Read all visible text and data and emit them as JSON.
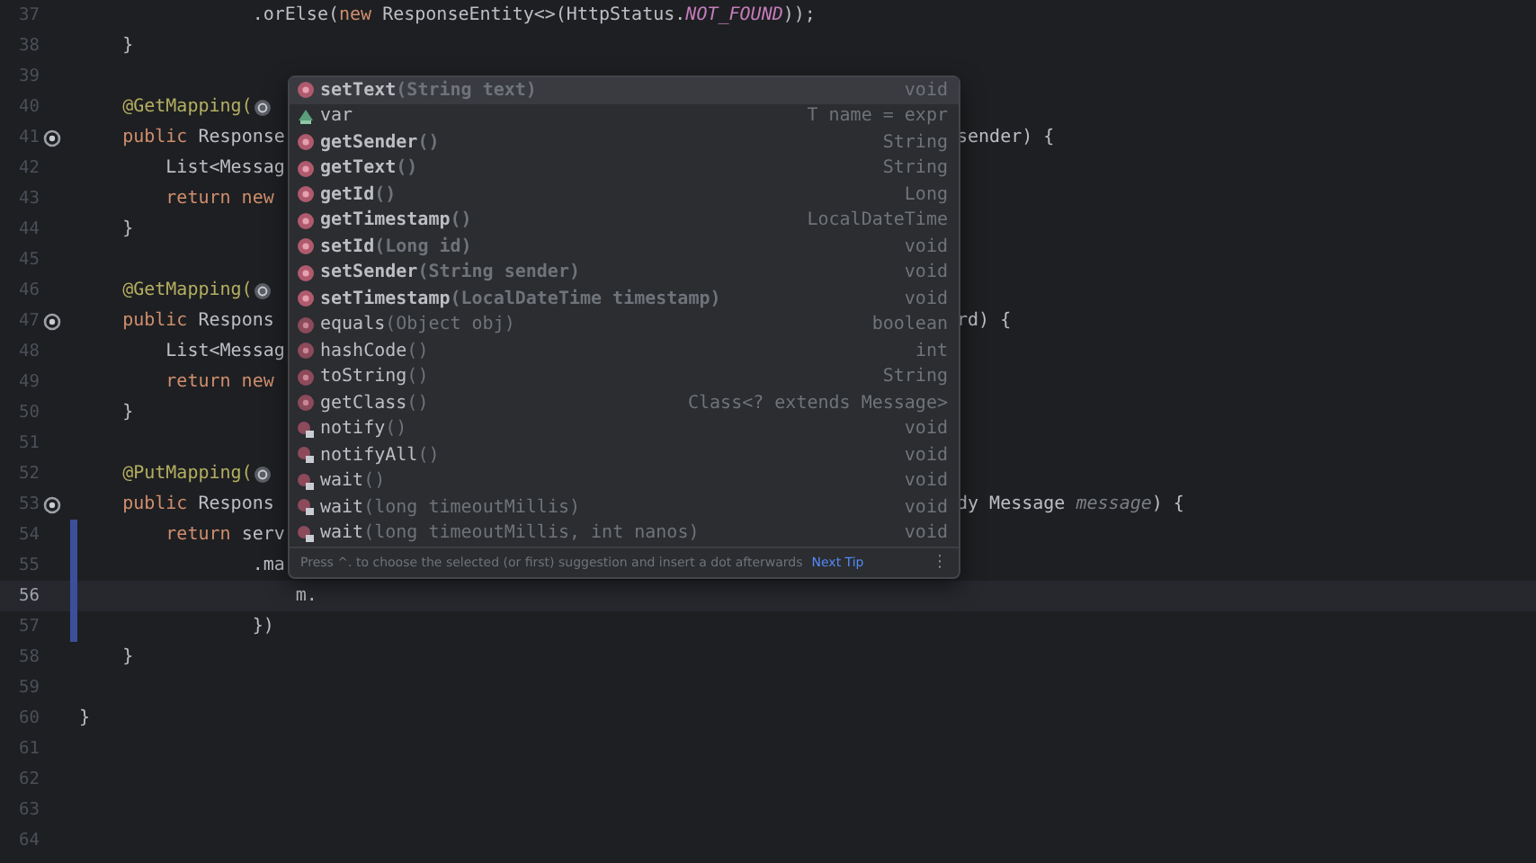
{
  "editor": {
    "lines": [
      {
        "number": "37",
        "segments": [
          {
            "text": "                .orElse(",
            "kind": "plain"
          },
          {
            "text": "new",
            "kind": "keyword"
          },
          {
            "text": " ResponseEntity<>(HttpStatus.",
            "kind": "plain"
          },
          {
            "text": "NOT_FOUND",
            "kind": "constant"
          },
          {
            "text": "));",
            "kind": "plain"
          }
        ]
      },
      {
        "number": "38",
        "segments": [
          {
            "text": "    }",
            "kind": "plain"
          }
        ]
      },
      {
        "number": "39"
      },
      {
        "number": "40",
        "segments": [
          {
            "text": "    @GetMapping(",
            "kind": "annotation"
          }
        ],
        "hint": true
      },
      {
        "number": "41",
        "segments": [
          {
            "text": "    public",
            "kind": "keyword"
          },
          {
            "text": " Response",
            "kind": "plain"
          }
        ],
        "right": [
          {
            "text": "sender) {",
            "kind": "plain"
          }
        ],
        "gutter_icon": true
      },
      {
        "number": "42",
        "segments": [
          {
            "text": "        List<Messag",
            "kind": "plain"
          }
        ]
      },
      {
        "number": "43",
        "segments": [
          {
            "text": "        return new",
            "kind": "keyword"
          }
        ]
      },
      {
        "number": "44",
        "segments": [
          {
            "text": "    }",
            "kind": "plain"
          }
        ]
      },
      {
        "number": "45"
      },
      {
        "number": "46",
        "segments": [
          {
            "text": "    @GetMapping(",
            "kind": "annotation"
          }
        ],
        "hint": true
      },
      {
        "number": "47",
        "segments": [
          {
            "text": "    public",
            "kind": "keyword"
          },
          {
            "text": " Respons",
            "kind": "plain"
          }
        ],
        "right": [
          {
            "text": "rd) {",
            "kind": "plain"
          }
        ],
        "gutter_icon": true
      },
      {
        "number": "48",
        "segments": [
          {
            "text": "        List<Messag",
            "kind": "plain"
          }
        ]
      },
      {
        "number": "49",
        "segments": [
          {
            "text": "        return new",
            "kind": "keyword"
          }
        ]
      },
      {
        "number": "50",
        "segments": [
          {
            "text": "    }",
            "kind": "plain"
          }
        ]
      },
      {
        "number": "51"
      },
      {
        "number": "52",
        "segments": [
          {
            "text": "    @PutMapping(",
            "kind": "annotation"
          }
        ],
        "hint": true
      },
      {
        "number": "53",
        "segments": [
          {
            "text": "    public",
            "kind": "keyword"
          },
          {
            "text": " Respons",
            "kind": "plain"
          }
        ],
        "right": [
          {
            "text": "dy Message ",
            "kind": "plain"
          },
          {
            "text": "message",
            "kind": "param"
          },
          {
            "text": ") {",
            "kind": "plain"
          }
        ],
        "gutter_icon": true
      },
      {
        "number": "54",
        "segments": [
          {
            "text": "        return",
            "kind": "keyword"
          },
          {
            "text": " serv",
            "kind": "plain"
          }
        ],
        "changed": true
      },
      {
        "number": "55",
        "segments": [
          {
            "text": "                .ma",
            "kind": "plain"
          }
        ],
        "changed": true
      },
      {
        "number": "56",
        "segments": [
          {
            "text": "                    m.",
            "kind": "plain"
          }
        ],
        "changed": true,
        "current": true
      },
      {
        "number": "57",
        "segments": [
          {
            "text": "                })",
            "kind": "plain"
          }
        ],
        "changed": true
      },
      {
        "number": "58",
        "segments": [
          {
            "text": "    }",
            "kind": "plain"
          }
        ]
      },
      {
        "number": "59"
      },
      {
        "number": "60",
        "segments": [
          {
            "text": "}",
            "kind": "plain"
          }
        ]
      },
      {
        "number": "61"
      },
      {
        "number": "62"
      },
      {
        "number": "63"
      },
      {
        "number": "64"
      }
    ]
  },
  "completion": {
    "items": [
      {
        "name": "setText",
        "params": "(String text)",
        "type": "void",
        "kind": "member",
        "selected": true
      },
      {
        "name": "var",
        "type": "T name = expr",
        "kind": "template",
        "selected": false
      },
      {
        "name": "getSender",
        "params": "()",
        "type": "String",
        "kind": "member",
        "selected": false
      },
      {
        "name": "getText",
        "params": "()",
        "type": "String",
        "kind": "member",
        "selected": false
      },
      {
        "name": "getId",
        "params": "()",
        "type": "Long",
        "kind": "member",
        "selected": false
      },
      {
        "name": "getTimestamp",
        "params": "()",
        "type": "LocalDateTime",
        "kind": "member",
        "selected": false
      },
      {
        "name": "setId",
        "params": "(Long id)",
        "type": "void",
        "kind": "member",
        "selected": false
      },
      {
        "name": "setSender",
        "params": "(String sender)",
        "type": "void",
        "kind": "member",
        "selected": false
      },
      {
        "name": "setTimestamp",
        "params": "(LocalDateTime timestamp)",
        "type": "void",
        "kind": "member",
        "selected": false
      },
      {
        "name": "equals",
        "params": "(Object obj)",
        "type": "boolean",
        "kind": "inherited",
        "selected": false
      },
      {
        "name": "hashCode",
        "params": "()",
        "type": "int",
        "kind": "inherited",
        "selected": false
      },
      {
        "name": "toString",
        "params": "()",
        "type": "String",
        "kind": "inherited",
        "selected": false
      },
      {
        "name": "getClass",
        "params": "()",
        "type": "Class<? extends Message>",
        "kind": "inherited",
        "selected": false
      },
      {
        "name": "notify",
        "params": "()",
        "type": "void",
        "kind": "final",
        "selected": false
      },
      {
        "name": "notifyAll",
        "params": "()",
        "type": "void",
        "kind": "final",
        "selected": false
      },
      {
        "name": "wait",
        "params": "()",
        "type": "void",
        "kind": "final",
        "selected": false
      },
      {
        "name": "wait",
        "params": "(long timeoutMillis)",
        "type": "void",
        "kind": "final",
        "selected": false
      },
      {
        "name": "wait",
        "params": "(long timeoutMillis, int nanos)",
        "type": "void",
        "kind": "final",
        "selected": false
      }
    ],
    "tip": "Press ^. to choose the selected (or first) suggestion and insert a dot afterwards",
    "tip_link": "Next Tip",
    "menu": "⋮"
  }
}
